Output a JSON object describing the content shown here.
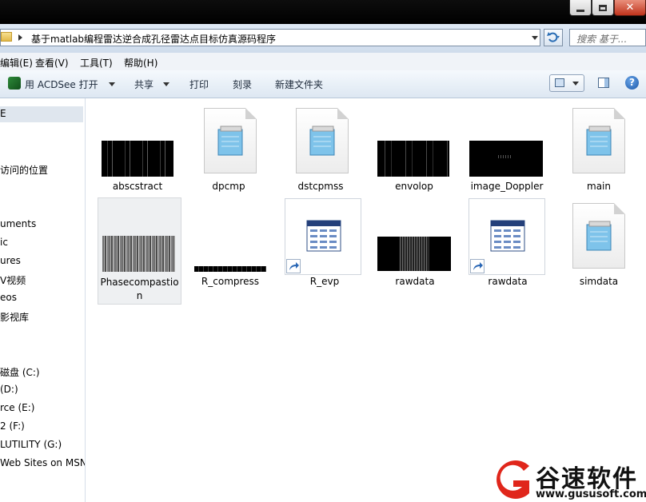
{
  "window": {
    "minimize_label": "minimize",
    "maximize_label": "maximize",
    "close_label": "close"
  },
  "address": {
    "path": "基于matlab编程雷达逆合成孔径雷达点目标仿真源码程序",
    "search_placeholder": "搜索 基于..."
  },
  "menu": {
    "items": [
      "编辑(E)",
      "查看(V)",
      "工具(T)",
      "帮助(H)"
    ]
  },
  "toolbar": {
    "open_with": "用 ACDSee 打开",
    "share": "共享",
    "print": "打印",
    "burn": "刻录",
    "new_folder": "新建文件夹"
  },
  "nav": {
    "items": [
      "E",
      "访问的位置",
      "uments",
      "ic",
      "ures",
      "V视频",
      "eos",
      "影视库",
      "磁盘 (C:)",
      " (D:)",
      "rce (E:)",
      "2 (F:)",
      "LUTILITY (G:)",
      "Web Sites on MSN"
    ]
  },
  "files": [
    {
      "name": "abscstract",
      "kind": "image"
    },
    {
      "name": "dpcmp",
      "kind": "doc"
    },
    {
      "name": "dstcpmss",
      "kind": "doc"
    },
    {
      "name": "envolop",
      "kind": "image"
    },
    {
      "name": "image_Doppler",
      "kind": "image"
    },
    {
      "name": "main",
      "kind": "doc"
    },
    {
      "name": "Phasecompastion",
      "kind": "image"
    },
    {
      "name": "R_compress",
      "kind": "image"
    },
    {
      "name": "R_evp",
      "kind": "table"
    },
    {
      "name": "rawdata",
      "kind": "image"
    },
    {
      "name": "rawdata",
      "kind": "table"
    },
    {
      "name": "simdata",
      "kind": "doc"
    }
  ],
  "watermark": {
    "brand": "谷速软件",
    "url": "www.gususoft.com"
  },
  "colors": {
    "accent_red": "#e0261b",
    "selection": "#eef0f2"
  }
}
